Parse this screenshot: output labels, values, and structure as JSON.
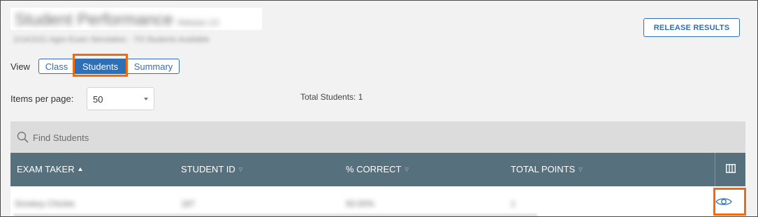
{
  "header": {
    "title": "Student Performance",
    "title_suffix": "Release 1/3",
    "subtitle": "1/14/2021 Ages Exam Simulation · 7/3 Students Available"
  },
  "release_button": {
    "label": "RELEASE RESULTS"
  },
  "view": {
    "label": "View",
    "options": [
      {
        "label": "Class",
        "selected": false
      },
      {
        "label": "Students",
        "selected": true
      },
      {
        "label": "Summary",
        "selected": false
      }
    ]
  },
  "pagination": {
    "items_per_page_label": "Items per page:",
    "items_per_page_value": "50",
    "total_text": "Total Students: 1"
  },
  "search": {
    "placeholder": "Find Students"
  },
  "table": {
    "columns": [
      {
        "label": "EXAM TAKER",
        "sort": "asc"
      },
      {
        "label": "STUDENT ID",
        "sort": "none"
      },
      {
        "label": "% CORRECT",
        "sort": "none"
      },
      {
        "label": "TOTAL POINTS",
        "sort": "none"
      }
    ],
    "rows": [
      {
        "exam_taker": "Smokey Chickie",
        "student_id": "187",
        "percent_correct": "50.00%",
        "total_points": "1"
      }
    ]
  },
  "colors": {
    "accent": "#2f6fb6",
    "highlight": "#f06a0f",
    "table_header": "#56707e",
    "search_bg": "#dcdcdc",
    "page_bg": "#f2f2f2"
  },
  "icons": {
    "search": "search-icon",
    "sort_asc": "sort-asc-icon",
    "sort_desc": "sort-icon",
    "columns": "columns-icon",
    "view": "eye-icon",
    "dropdown": "chevron-down-icon"
  }
}
